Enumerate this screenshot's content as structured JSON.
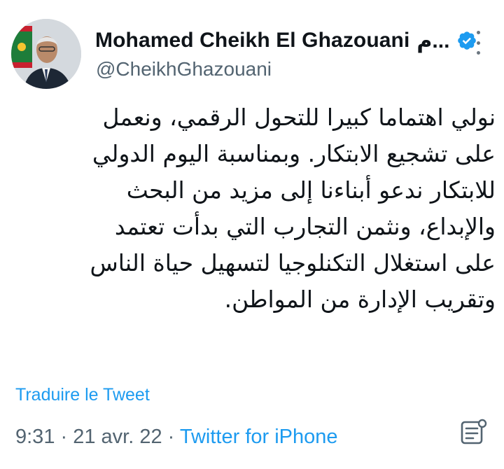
{
  "tweet": {
    "author": {
      "display_name": "Mohamed Cheikh El Ghazouani",
      "display_name_suffix": "م...",
      "handle": "@CheikhGhazouani",
      "verified": true
    },
    "text_lines": [
      "نولي اهتماما كبيرا للتحول الرقمي، ونعمل",
      "على تشجيع الابتكار. وبمناسبة اليوم الدولي",
      "للابتكار ندعو أبناءنا  إلى مزيد من البحث",
      "والإبداع، ونثمن التجارب التي بدأت تعتمد",
      "على استغلال التكنلوجيا لتسهيل حياة الناس",
      "وتقريب الإدارة من المواطن."
    ],
    "translate_label": "Traduire le Tweet",
    "time": "9:31",
    "separator": " · ",
    "date": "21 avr. 22",
    "source": "Twitter for iPhone"
  },
  "icons": {
    "verified": "verified-badge-icon",
    "more": "more-options-icon",
    "analytics": "tweet-analytics-icon"
  },
  "colors": {
    "accent": "#1d9bf0",
    "text": "#0f1419",
    "secondary": "#536471"
  }
}
